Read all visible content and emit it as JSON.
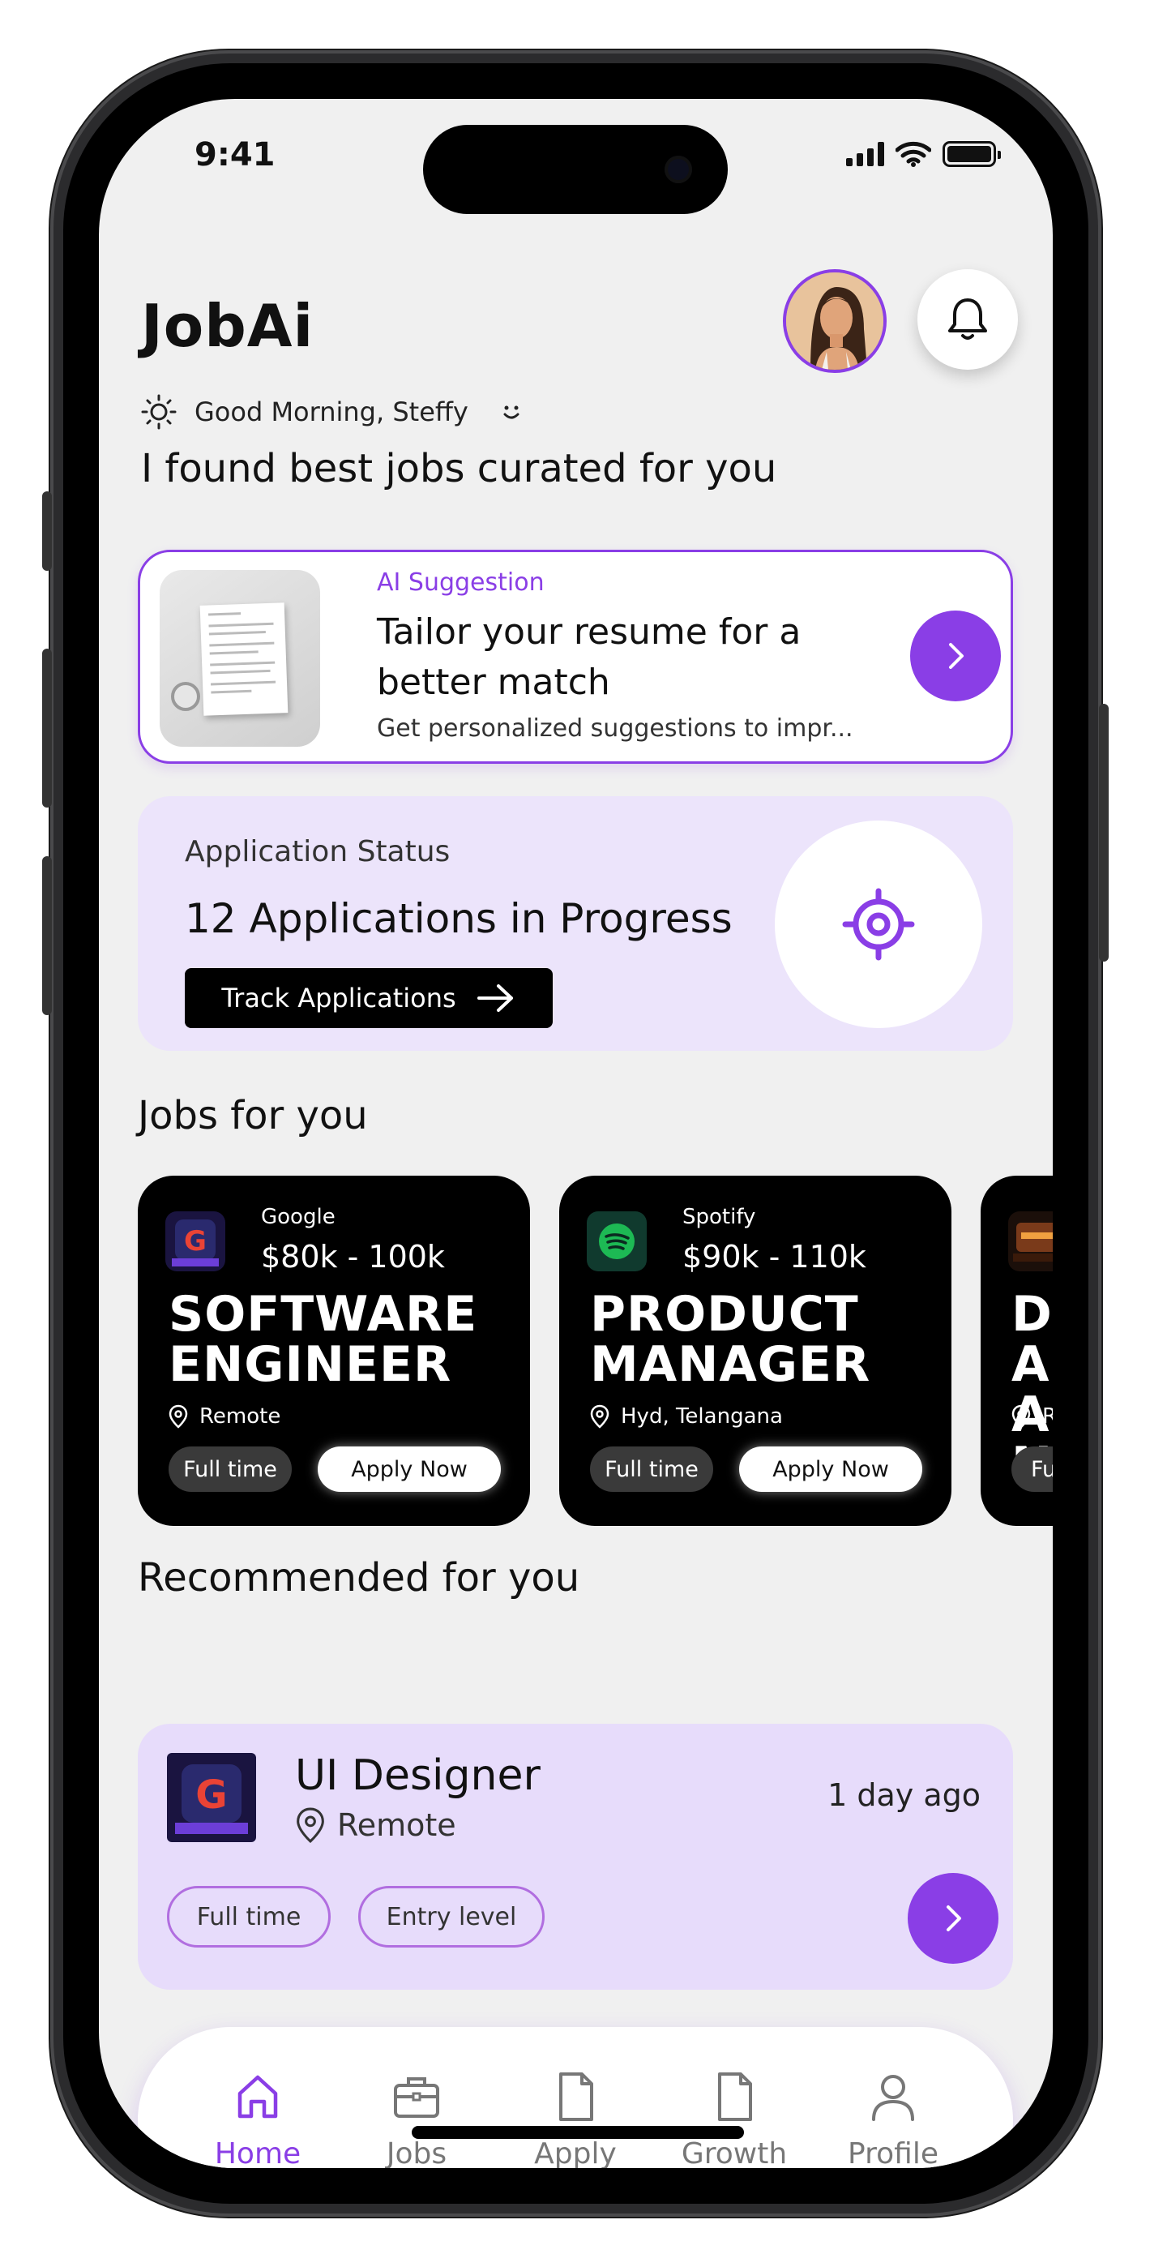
{
  "status_bar": {
    "time": "9:41"
  },
  "header": {
    "app_title": "JobAi",
    "greeting": "Good Morning, Steffy",
    "subtitle": "I found best jobs curated for you"
  },
  "ai_suggestion": {
    "label": "AI Suggestion",
    "title": "Tailor your resume for a better match",
    "description": "Get personalized suggestions to impr..."
  },
  "application_status": {
    "label": "Application Status",
    "title": "12 Applications in Progress",
    "button_label": "Track Applications"
  },
  "jobs_section": {
    "title": "Jobs for you",
    "jobs": [
      {
        "company": "Google",
        "salary": "$80k - 100k",
        "title": "SOFTWARE ENGINEER",
        "location": "Remote",
        "type": "Full time",
        "apply_label": "Apply Now",
        "logo": "google-logo"
      },
      {
        "company": "Spotify",
        "salary": "$90k - 110k",
        "title": "PRODUCT MANAGER",
        "location": "Hyd, Telangana",
        "type": "Full time",
        "apply_label": "Apply Now",
        "logo": "spotify-logo"
      },
      {
        "title_partial": "DA AN",
        "location_partial": "Re",
        "type_partial": "Full",
        "logo": "amazon-logo"
      }
    ]
  },
  "recommended_section": {
    "title": "Recommended for you",
    "item": {
      "title": "UI Designer",
      "location": "Remote",
      "posted": "1 day ago",
      "tags": [
        "Full time",
        "Entry level"
      ],
      "logo": "google-logo"
    }
  },
  "bottom_nav": {
    "items": [
      {
        "label": "Home",
        "icon": "home-icon",
        "active": true
      },
      {
        "label": "Jobs",
        "icon": "briefcase-icon",
        "active": false
      },
      {
        "label": "Apply",
        "icon": "document-icon",
        "active": false
      },
      {
        "label": "Growth",
        "icon": "document-icon",
        "active": false
      },
      {
        "label": "Profile",
        "icon": "user-icon",
        "active": false
      }
    ]
  },
  "colors": {
    "accent": "#8a3ee6",
    "card_lavender": "#ece4fb",
    "screen_bg": "#f0f0f0"
  }
}
